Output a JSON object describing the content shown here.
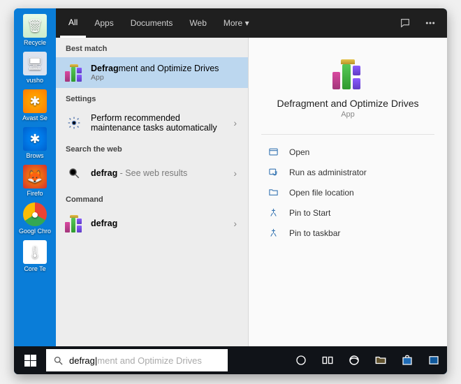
{
  "desktop": {
    "icons": [
      {
        "label": "Recycle"
      },
      {
        "label": ""
      },
      {
        "label": "vusho"
      },
      {
        "label": "Avast Se"
      },
      {
        "label": "Brows"
      },
      {
        "label": "Firefo"
      },
      {
        "label": "Googl Chro"
      },
      {
        "label": "Core Te"
      }
    ]
  },
  "tabs": {
    "all": "All",
    "apps": "Apps",
    "documents": "Documents",
    "web": "Web",
    "more": "More"
  },
  "sections": {
    "best_match": "Best match",
    "settings": "Settings",
    "search_web": "Search the web",
    "command": "Command"
  },
  "results": {
    "best": {
      "typed": "Defrag",
      "rest": "ment and Optimize Drives",
      "sub": "App"
    },
    "settings": {
      "title": "Perform recommended maintenance tasks automatically"
    },
    "web": {
      "typed": "defrag",
      "hint": " - See web results"
    },
    "command": {
      "title": "defrag"
    }
  },
  "preview": {
    "title": "Defragment and Optimize Drives",
    "type": "App",
    "actions": {
      "open": "Open",
      "run_admin": "Run as administrator",
      "open_loc": "Open file location",
      "pin_start": "Pin to Start",
      "pin_taskbar": "Pin to taskbar"
    }
  },
  "search": {
    "typed": "defrag",
    "ghost": "ment and Optimize Drives"
  }
}
